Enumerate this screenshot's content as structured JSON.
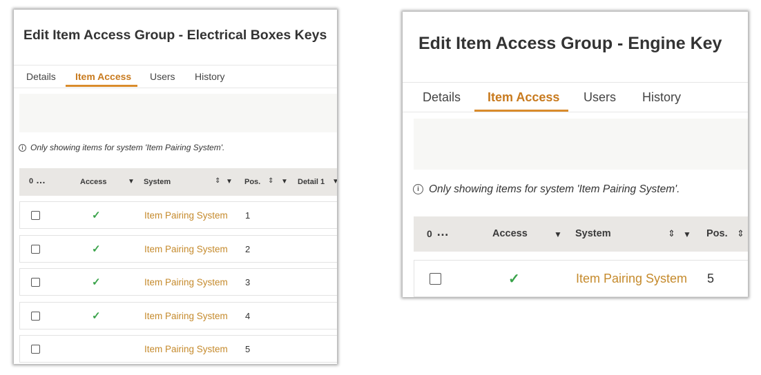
{
  "left_panel": {
    "title": "Edit Item Access Group - Electrical Boxes Keys",
    "tabs": [
      {
        "label": "Details"
      },
      {
        "label": "Item Access"
      },
      {
        "label": "Users"
      },
      {
        "label": "History"
      }
    ],
    "active_tab": "Item Access",
    "info_text": "Only showing items for system 'Item Pairing System'.",
    "columns": {
      "select_count": "0",
      "more": "…",
      "access": "Access",
      "system": "System",
      "pos": "Pos.",
      "detail1": "Detail 1"
    },
    "rows": [
      {
        "access": "✓",
        "system": "Item Pairing System",
        "pos": "1"
      },
      {
        "access": "✓",
        "system": "Item Pairing System",
        "pos": "2"
      },
      {
        "access": "✓",
        "system": "Item Pairing System",
        "pos": "3"
      },
      {
        "access": "✓",
        "system": "Item Pairing System",
        "pos": "4"
      },
      {
        "access": "",
        "system": "Item Pairing System",
        "pos": "5"
      }
    ]
  },
  "right_panel": {
    "title": "Edit Item Access Group - Engine Key",
    "tabs": [
      {
        "label": "Details"
      },
      {
        "label": "Item Access"
      },
      {
        "label": "Users"
      },
      {
        "label": "History"
      }
    ],
    "active_tab": "Item Access",
    "info_text": "Only showing items for system 'Item Pairing System'.",
    "columns": {
      "select_count": "0",
      "more": "…",
      "access": "Access",
      "system": "System",
      "pos": "Pos."
    },
    "rows": [
      {
        "access": "✓",
        "system": "Item Pairing System",
        "pos": "5"
      }
    ]
  },
  "icons": {
    "sort": "sort-icon",
    "filter": "filter-icon",
    "info": "info-icon",
    "check": "checkmark-icon",
    "more": "more-icon"
  },
  "colors": {
    "accent": "#c87a1e",
    "tab_underline": "#d98b2b",
    "link": "#c58a2c",
    "check": "#3aa34a",
    "header_bg": "#e9e7e4",
    "filter_bg": "#f7f7f5"
  }
}
